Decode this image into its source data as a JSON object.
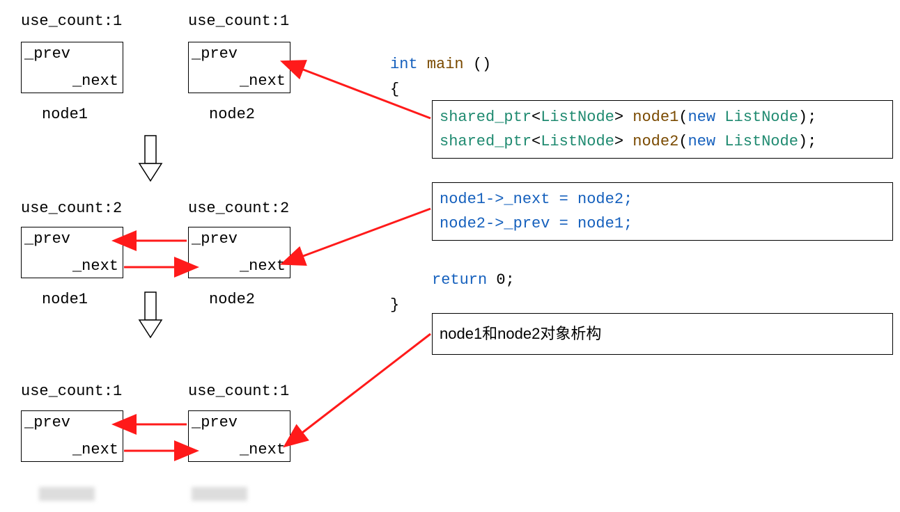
{
  "stages": [
    {
      "node1": {
        "use_count": "use_count:1",
        "prev": "_prev",
        "next": "_next",
        "label": "node1"
      },
      "node2": {
        "use_count": "use_count:1",
        "prev": "_prev",
        "next": "_next",
        "label": "node2"
      }
    },
    {
      "node1": {
        "use_count": "use_count:2",
        "prev": "_prev",
        "next": "_next",
        "label": "node1"
      },
      "node2": {
        "use_count": "use_count:2",
        "prev": "_prev",
        "next": "_next",
        "label": "node2"
      }
    },
    {
      "node1": {
        "use_count": "use_count:1",
        "prev": "_prev",
        "next": "_next",
        "label": ""
      },
      "node2": {
        "use_count": "use_count:1",
        "prev": "_prev",
        "next": "_next",
        "label": ""
      }
    }
  ],
  "code": {
    "line1": {
      "int": "int",
      "main": "main",
      "parens": "()"
    },
    "brace_open": "{",
    "box1": {
      "l1": {
        "shared_ptr": "shared_ptr",
        "lt": "<",
        "ListNode": "ListNode",
        "gt": ">",
        "sp": " ",
        "node": "node1",
        "op": "(",
        "new": "new",
        "sp2": " ",
        "ListNode2": "ListNode",
        "cp": ")",
        "semi": ";"
      },
      "l2": {
        "shared_ptr": "shared_ptr",
        "lt": "<",
        "ListNode": "ListNode",
        "gt": ">",
        "sp": " ",
        "node": "node2",
        "op": "(",
        "new": "new",
        "sp2": " ",
        "ListNode2": "ListNode",
        "cp": ")",
        "semi": ";"
      }
    },
    "box2": {
      "l1": "node1->_next = node2;",
      "l2": "node2->_prev = node1;"
    },
    "return": {
      "return": "return",
      "sp": " ",
      "zero": "0",
      "semi": ";"
    },
    "brace_close": "}",
    "box3": {
      "text": "node1和node2对象析构"
    }
  }
}
